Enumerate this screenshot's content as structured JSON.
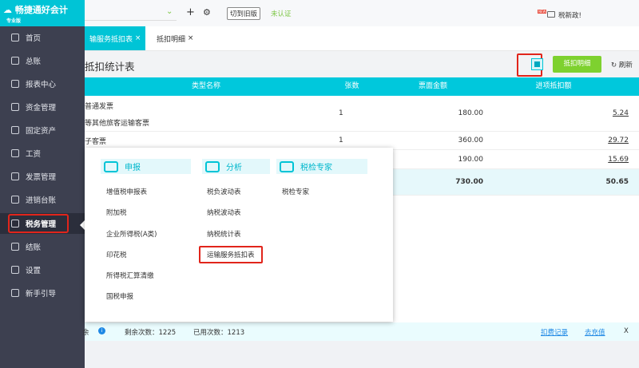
{
  "app": {
    "name": "畅捷通好会计",
    "edition": "专业版"
  },
  "topbar": {
    "switch_label": "切到旧版",
    "auth_status": "未认证",
    "news_badge": "NEW",
    "news_label": "税新政!"
  },
  "sidebar": {
    "items": [
      {
        "label": "首页"
      },
      {
        "label": "总账"
      },
      {
        "label": "报表中心"
      },
      {
        "label": "资金管理"
      },
      {
        "label": "固定资产"
      },
      {
        "label": "工资"
      },
      {
        "label": "发票管理"
      },
      {
        "label": "进销台账"
      },
      {
        "label": "税务管理"
      },
      {
        "label": "结账"
      },
      {
        "label": "设置"
      },
      {
        "label": "新手引导"
      }
    ]
  },
  "tabs": [
    {
      "label": "输服务抵扣表",
      "close": "×"
    },
    {
      "label": "抵扣明细",
      "close": "×"
    }
  ],
  "page": {
    "title": "抵扣统计表",
    "detail_button": "抵扣明细",
    "refresh_label": "刷新"
  },
  "table": {
    "headers": [
      "类型名称",
      "张数",
      "票面金额",
      "进项抵扣额"
    ],
    "rows": [
      {
        "name": "普通发票",
        "name2": "等其他旅客运输客票",
        "count": "1",
        "amount": "180.00",
        "deduct": "5.24"
      },
      {
        "name": "子客票",
        "count": "1",
        "amount": "360.00",
        "deduct": "29.72"
      },
      {
        "name": "",
        "count": "",
        "amount": "190.00",
        "deduct": "15.69"
      }
    ],
    "total": {
      "amount": "730.00",
      "deduct": "50.65"
    }
  },
  "popup": {
    "columns": [
      {
        "title": "申报",
        "items": [
          "增值税申报表",
          "附加税",
          "企业所得税(A类)",
          "印花税",
          "所得税汇算清缴",
          "国税申报"
        ]
      },
      {
        "title": "分析",
        "items": [
          "税负波动表",
          "纳税波动表",
          "纳税统计表",
          "运输服务抵扣表"
        ]
      },
      {
        "title": "税检专家",
        "items": [
          "税检专家"
        ]
      }
    ]
  },
  "notice": {
    "prefix": "余",
    "remaining": "剩余次数：1225",
    "used": "已用次数：1213",
    "record_link": "扣费记录",
    "recharge_link": "去充值",
    "close": "X"
  }
}
